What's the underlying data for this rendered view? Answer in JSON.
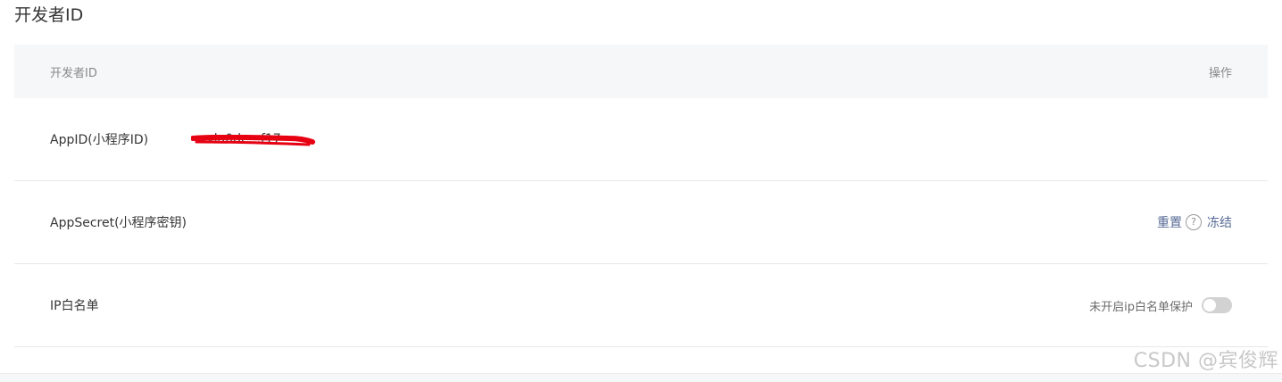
{
  "page": {
    "title": "开发者ID"
  },
  "table": {
    "header": {
      "col_name": "开发者ID",
      "col_ops": "操作"
    },
    "rows": [
      {
        "label": "AppID(小程序ID)",
        "value": "wxla0de...f17"
      },
      {
        "label": "AppSecret(小程序密钥)",
        "reset_label": "重置",
        "help_glyph": "?",
        "freeze_label": "冻结"
      },
      {
        "label": "IP白名单",
        "status": "未开启ip白名单保护",
        "toggle_on": false
      }
    ]
  },
  "watermark": "CSDN @宾俊辉",
  "colors": {
    "link": "#576b95",
    "header_bg": "#f6f7f9",
    "redaction": "#e60012",
    "toggle_off": "#d2d2d2"
  }
}
